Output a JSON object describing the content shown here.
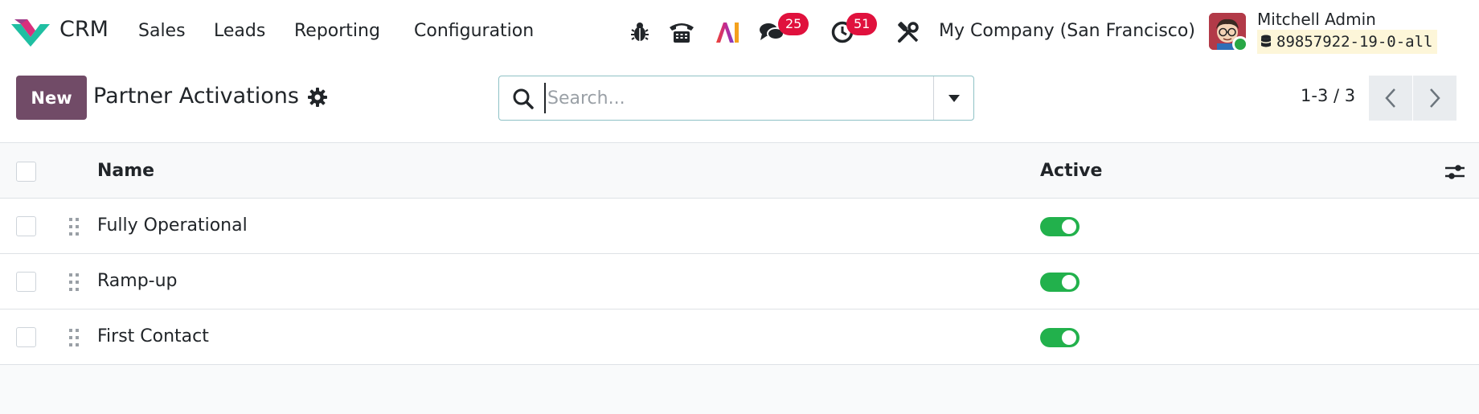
{
  "navbar": {
    "app_name": "CRM",
    "menu": [
      {
        "label": "Sales"
      },
      {
        "label": "Leads"
      },
      {
        "label": "Reporting"
      },
      {
        "label": "Configuration"
      }
    ],
    "messages_count": "25",
    "activities_count": "51",
    "company": "My Company (San Francisco)",
    "user_name": "Mitchell Admin",
    "database": "89857922-19-0-all"
  },
  "control": {
    "new_label": "New",
    "title": "Partner Activations",
    "search_placeholder": "Search...",
    "pager": "1-3 / 3"
  },
  "list": {
    "columns": {
      "name": "Name",
      "active": "Active"
    },
    "rows": [
      {
        "name": "Fully Operational",
        "active": true
      },
      {
        "name": "Ramp-up",
        "active": true
      },
      {
        "name": "First Contact",
        "active": true
      }
    ]
  },
  "colors": {
    "brand": "#714b67",
    "toggle_on": "#22b14c",
    "badge": "#e0113d"
  },
  "icons": {
    "bug": "bug-icon",
    "phone": "phone-icon",
    "ai": "ai-icon",
    "chat": "chat-icon",
    "clock": "clock-icon",
    "tools": "tools-icon",
    "gear": "gear-icon",
    "search": "search-icon",
    "caret": "caret-down-icon",
    "prev": "chevron-left-icon",
    "next": "chevron-right-icon",
    "handle": "drag-handle-icon",
    "optional_columns": "sliders-icon"
  }
}
